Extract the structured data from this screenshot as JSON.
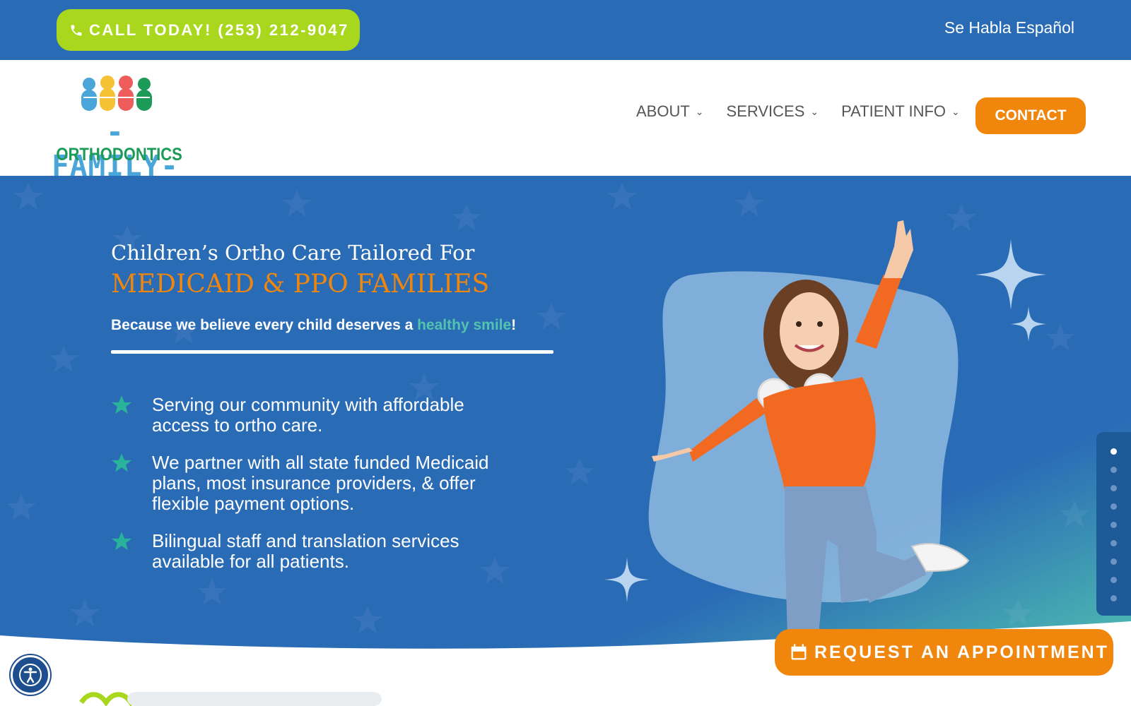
{
  "topbar": {
    "call_label": "CALL TODAY! (253) 212-9047",
    "spanish_label": "Se Habla Español"
  },
  "header": {
    "logo_line1": "-FAMILY-",
    "logo_line2": "ORTHODONTICS",
    "nav": [
      {
        "label": "ABOUT"
      },
      {
        "label": "SERVICES"
      },
      {
        "label": "PATIENT INFO"
      }
    ],
    "contact_label": "CONTACT"
  },
  "hero": {
    "title_line1": "Children’s Ortho Care Tailored For",
    "title_line2": "MEDICAID & PPO FAMILIES",
    "tagline_pre": "Because we believe every child deserves a ",
    "tagline_highlight": "healthy smile",
    "tagline_post": "!",
    "bullets": [
      {
        "text": "Serving our community with affordable access to ortho care."
      },
      {
        "text": "We partner with all state funded Medicaid plans, most insurance providers, & offer flexible payment options."
      },
      {
        "text": "Bilingual staff and translation services available for all patients."
      }
    ]
  },
  "slider": {
    "count": 9,
    "active": 1
  },
  "cta": {
    "request_label": "REQUEST AN APPOINTMENT"
  },
  "colors": {
    "brand_blue": "#2a6bb6",
    "lime": "#a8d71e",
    "orange": "#f0860c",
    "teal": "#52c3ae"
  },
  "icons": {
    "phone": "phone-icon",
    "calendar": "calendar-icon",
    "accessibility": "accessibility-icon",
    "bullet": "star-icon"
  }
}
